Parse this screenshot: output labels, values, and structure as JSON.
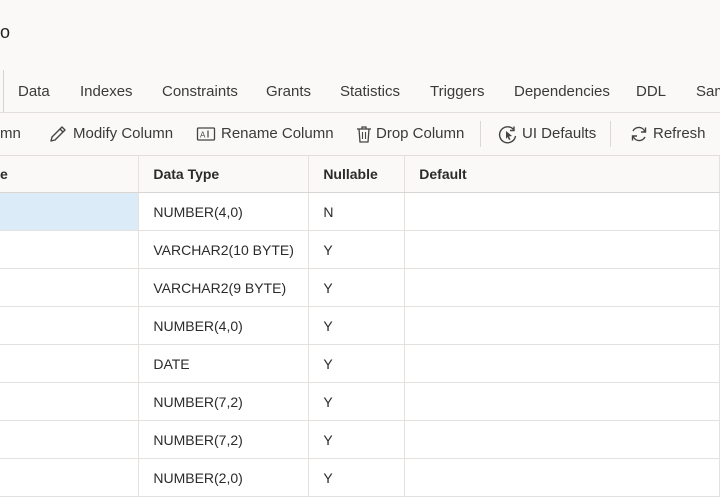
{
  "header": {
    "title_fragment": "o"
  },
  "tabs": [
    {
      "label": "Data"
    },
    {
      "label": "Indexes"
    },
    {
      "label": "Constraints"
    },
    {
      "label": "Grants"
    },
    {
      "label": "Statistics"
    },
    {
      "label": "Triggers"
    },
    {
      "label": "Dependencies"
    },
    {
      "label": "DDL"
    },
    {
      "label": "Sam"
    }
  ],
  "toolbar": {
    "add_column_fragment": "mn",
    "modify_column": "Modify Column",
    "rename_column": "Rename Column",
    "drop_column": "Drop Column",
    "ui_defaults": "UI Defaults",
    "refresh": "Refresh"
  },
  "grid": {
    "columns": [
      "e",
      "Data Type",
      "Nullable",
      "Default"
    ],
    "rows": [
      {
        "name": "",
        "data_type": "NUMBER(4,0)",
        "nullable": "N",
        "default": "",
        "selected": true
      },
      {
        "name": "",
        "data_type": "VARCHAR2(10 BYTE)",
        "nullable": "Y",
        "default": ""
      },
      {
        "name": "",
        "data_type": "VARCHAR2(9 BYTE)",
        "nullable": "Y",
        "default": ""
      },
      {
        "name": "",
        "data_type": "NUMBER(4,0)",
        "nullable": "Y",
        "default": ""
      },
      {
        "name": "",
        "data_type": "DATE",
        "nullable": "Y",
        "default": ""
      },
      {
        "name": "",
        "data_type": "NUMBER(7,2)",
        "nullable": "Y",
        "default": ""
      },
      {
        "name": "",
        "data_type": "NUMBER(7,2)",
        "nullable": "Y",
        "default": ""
      },
      {
        "name": "",
        "data_type": "NUMBER(2,0)",
        "nullable": "Y",
        "default": ""
      }
    ]
  },
  "icons": {
    "modify": "pencil-icon",
    "rename": "rename-text-icon",
    "drop": "trash-icon",
    "ui_defaults": "ui-defaults-icon",
    "refresh": "refresh-icon"
  }
}
